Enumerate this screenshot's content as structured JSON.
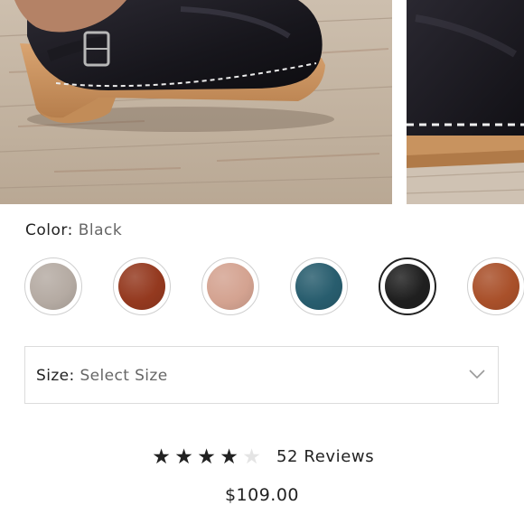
{
  "gallery": {
    "images": [
      {
        "icon": "black-clog-on-wooden-floor-photo"
      },
      {
        "icon": "black-clog-closeup-photo"
      }
    ]
  },
  "color": {
    "label": "Color:",
    "selected": "Black",
    "swatches": [
      {
        "name": "Taupe",
        "color": "#b5aba3",
        "selected": false
      },
      {
        "name": "Brown",
        "color": "#94391f",
        "selected": false
      },
      {
        "name": "Pink",
        "color": "#d4a391",
        "selected": false
      },
      {
        "name": "Teal",
        "color": "#285d6e",
        "selected": false
      },
      {
        "name": "Black",
        "color": "#1f1f1f",
        "selected": true
      },
      {
        "name": "Cognac",
        "color": "#a9502a",
        "selected": false
      }
    ]
  },
  "size": {
    "label": "Size:",
    "value": "Select Size",
    "icon": "chevron-down-icon"
  },
  "rating": {
    "stars": 4,
    "max": 5,
    "reviews_text": "52 Reviews"
  },
  "price": "$109.00"
}
